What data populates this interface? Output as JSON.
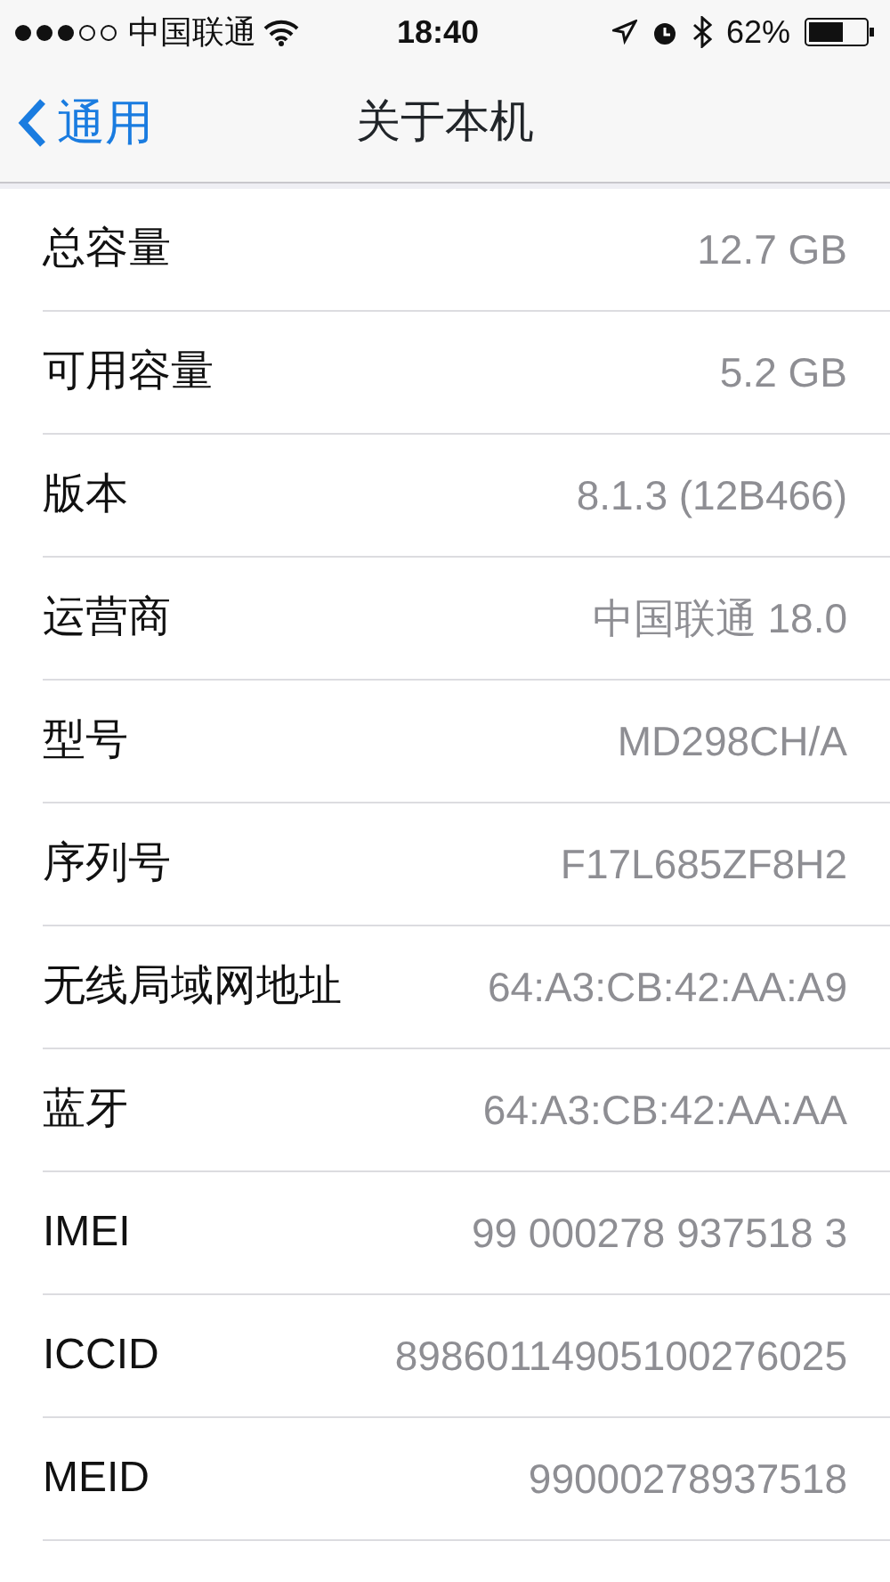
{
  "status_bar": {
    "carrier": "中国联通",
    "time": "18:40",
    "battery": "62%"
  },
  "nav": {
    "back": "通用",
    "title": "关于本机"
  },
  "rows": [
    {
      "label": "总容量",
      "value": "12.7 GB"
    },
    {
      "label": "可用容量",
      "value": "5.2 GB"
    },
    {
      "label": "版本",
      "value": "8.1.3 (12B466)"
    },
    {
      "label": "运营商",
      "value": "中国联通 18.0"
    },
    {
      "label": "型号",
      "value": "MD298CH/A"
    },
    {
      "label": "序列号",
      "value": "F17L685ZF8H2"
    },
    {
      "label": "无线局域网地址",
      "value": "64:A3:CB:42:AA:A9"
    },
    {
      "label": "蓝牙",
      "value": "64:A3:CB:42:AA:AA"
    },
    {
      "label": "IMEI",
      "value": "99 000278 937518 3"
    },
    {
      "label": "ICCID",
      "value": "89860114905100276025"
    },
    {
      "label": "MEID",
      "value": "99000278937518"
    }
  ]
}
